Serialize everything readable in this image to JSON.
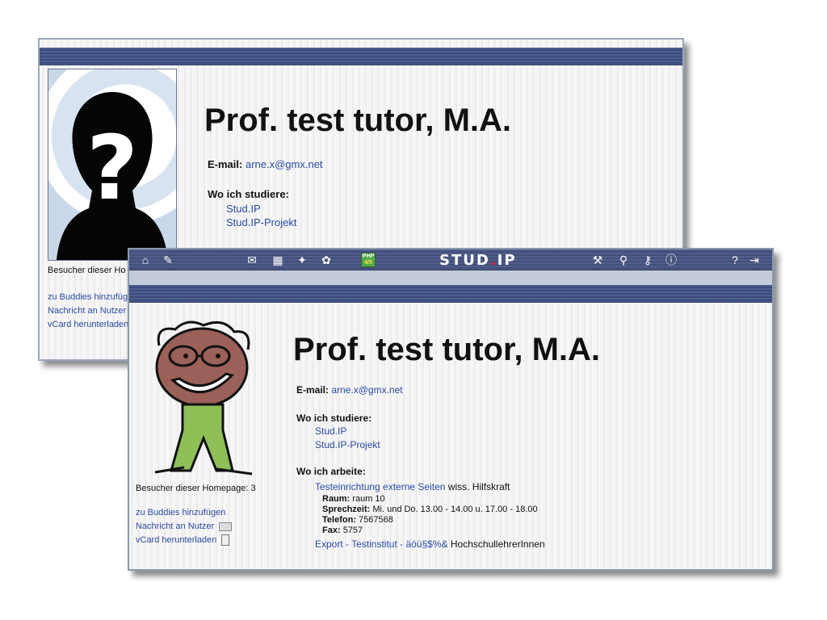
{
  "back": {
    "name": "Prof. test tutor, M.A.",
    "email_label": "E-mail:",
    "email": "arne.x@gmx.net",
    "studies_label": "Wo ich studiere:",
    "studies": [
      "Stud.IP",
      "Stud.IP-Projekt"
    ],
    "visitors": "Besucher dieser Ho",
    "links": [
      "zu Buddies hinzufüg",
      "Nachricht an Nutzer",
      "vCard herunterladen"
    ]
  },
  "toolbar": {
    "logo_left": "STUD",
    "logo_dot": ".",
    "logo_right": "IP",
    "php_line1": "PHP",
    "php_line2": "4/5",
    "help": "?"
  },
  "front": {
    "name": "Prof. test tutor, M.A.",
    "email_label": "E-mail:",
    "email": "arne.x@gmx.net",
    "studies_label": "Wo ich studiere:",
    "studies": [
      "Stud.IP",
      "Stud.IP-Projekt"
    ],
    "work_label": "Wo ich arbeite:",
    "work_link": "Testeinrichtung externe Seiten",
    "work_role": "wiss. Hilfskraft",
    "room_label": "Raum:",
    "room": "raum 10",
    "hours_label": "Sprechzeit:",
    "hours": "Mi. und Do. 13.00 - 14.00 u. 17.00 - 18.00",
    "phone_label": "Telefon:",
    "phone": "7567568",
    "fax_label": "Fax:",
    "fax": "5757",
    "export_link": "Export - Testinstitut - äöü§$%&",
    "export_role": "HochschullehrerInnen",
    "visitors": "Besucher dieser Homepage: 3",
    "links": [
      "zu Buddies hinzufügen",
      "Nachricht an Nutzer",
      "vCard herunterladen"
    ]
  }
}
